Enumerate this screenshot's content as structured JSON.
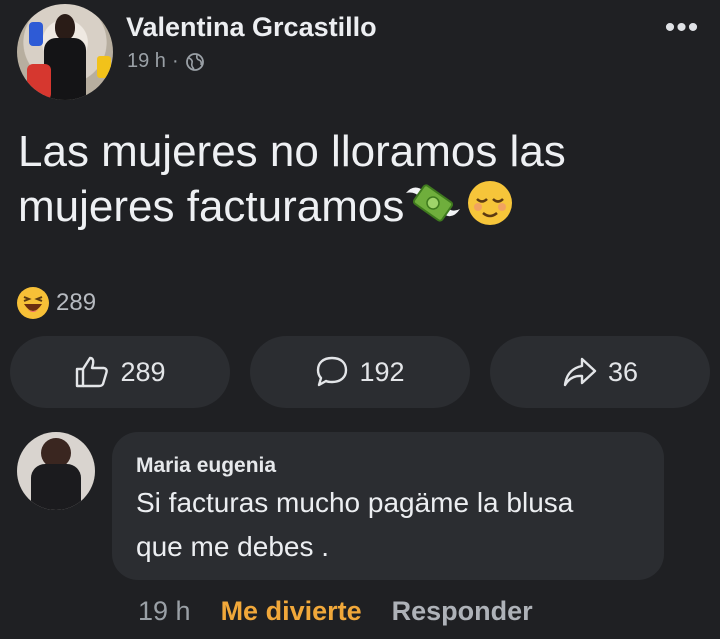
{
  "post": {
    "author": "Valentina Grcastillo",
    "time": "19 h",
    "separator": "·",
    "text_line1": "Las mujeres no lloramos las",
    "text_line2": "mujeres facturamos",
    "reaction_count": "289",
    "actions": {
      "like_count": "289",
      "comment_count": "192",
      "share_count": "36"
    }
  },
  "comment": {
    "author": "Maria eugenia",
    "text_line1": "Si facturas mucho pagäme la blusa",
    "text_line2": "que me debes .",
    "time": "19 h",
    "reaction_label": "Me divierte",
    "reply_label": "Responder"
  },
  "icons": {
    "globe": "globe-icon",
    "more": "more-icon",
    "money_wings": "money-with-wings-icon",
    "relieved_face": "relieved-face-icon",
    "haha": "haha-reaction-icon",
    "like": "thumbs-up-icon",
    "comment": "comment-icon",
    "share": "share-icon"
  },
  "colors": {
    "background": "#1f2023",
    "pill": "#2b2d31",
    "haha_accent": "#f1a83a",
    "secondary_text": "#9aa0a6"
  }
}
